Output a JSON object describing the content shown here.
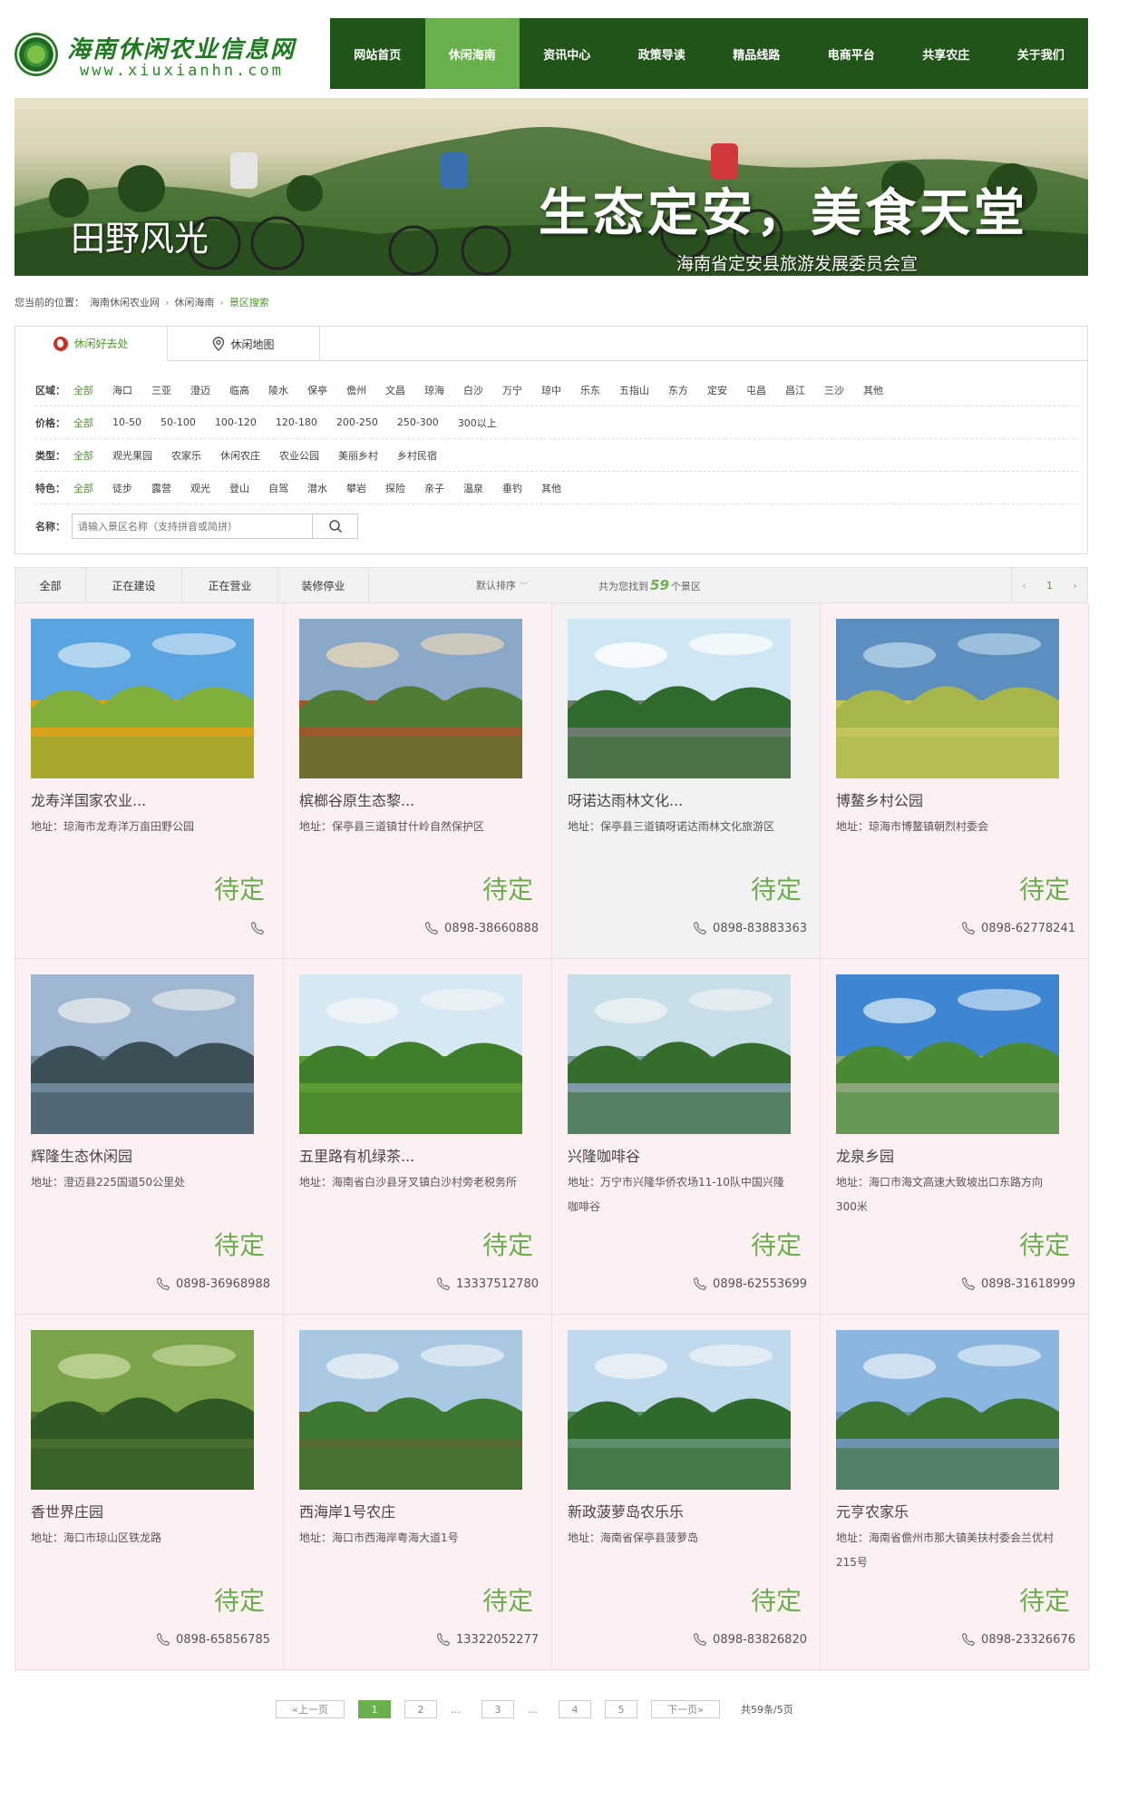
{
  "header": {
    "logo_title": "海南休闲农业信息网",
    "logo_url": "www.xiuxianhn.com",
    "nav": [
      {
        "label": "网站首页",
        "active": false
      },
      {
        "label": "休闲海南",
        "active": true
      },
      {
        "label": "资讯中心",
        "active": false
      },
      {
        "label": "政策导读",
        "active": false
      },
      {
        "label": "精品线路",
        "active": false
      },
      {
        "label": "电商平台",
        "active": false
      },
      {
        "label": "共享农庄",
        "active": false
      },
      {
        "label": "关于我们",
        "active": false
      }
    ]
  },
  "banner": {
    "left_text": "田野风光",
    "slogan": "生态定安，美食天堂",
    "credit": "海南省定安县旅游发展委员会宣"
  },
  "breadcrumb": {
    "prefix": "您当前的位置：",
    "items": [
      "海南休闲农业网",
      "休闲海南",
      "景区搜索"
    ]
  },
  "filter": {
    "tabs": [
      {
        "label": "休闲好去处",
        "icon": "globe-icon",
        "active": true
      },
      {
        "label": "休闲地图",
        "icon": "map-pin-icon",
        "active": false
      }
    ],
    "rows": [
      {
        "label": "区域：",
        "options": [
          "全部",
          "海口",
          "三亚",
          "澄迈",
          "临高",
          "陵水",
          "保亭",
          "儋州",
          "文昌",
          "琼海",
          "白沙",
          "万宁",
          "琼中",
          "乐东",
          "五指山",
          "东方",
          "定安",
          "屯昌",
          "昌江",
          "三沙",
          "其他"
        ]
      },
      {
        "label": "价格：",
        "options": [
          "全部",
          "10-50",
          "50-100",
          "100-120",
          "120-180",
          "200-250",
          "250-300",
          "300以上"
        ]
      },
      {
        "label": "类型：",
        "options": [
          "全部",
          "观光果园",
          "农家乐",
          "休闲农庄",
          "农业公园",
          "美丽乡村",
          "乡村民宿"
        ]
      },
      {
        "label": "特色：",
        "options": [
          "全部",
          "徒步",
          "露营",
          "观光",
          "登山",
          "自驾",
          "潜水",
          "攀岩",
          "探险",
          "亲子",
          "温泉",
          "垂钓",
          "其他"
        ]
      }
    ],
    "name_label": "名称：",
    "name_placeholder": "请输入景区名称（支持拼音或简拼）"
  },
  "sortbar": {
    "status_tabs": [
      "全部",
      "正在建设",
      "正在营业",
      "装修停业"
    ],
    "sort_label": "默认排序",
    "found_prefix": "共为您找到",
    "found_count": "59",
    "found_suffix": "个景区",
    "mini_page": "1"
  },
  "cards": [
    {
      "title": "龙寿洋国家农业...",
      "addr": "地址：琼海市龙寿洋万亩田野公园",
      "price": "待定",
      "phone": "",
      "hover": false
    },
    {
      "title": "槟榔谷原生态黎...",
      "addr": "地址：保亭县三道镇甘什岭自然保护区",
      "price": "待定",
      "phone": "0898-38660888",
      "hover": false
    },
    {
      "title": "呀诺达雨林文化...",
      "addr": "地址：保亭县三道镇呀诺达雨林文化旅游区",
      "price": "待定",
      "phone": "0898-83883363",
      "hover": true
    },
    {
      "title": "博鳌乡村公园",
      "addr": "地址：琼海市博鳌镇朝烈村委会",
      "price": "待定",
      "phone": "0898-62778241",
      "hover": false
    },
    {
      "title": "辉隆生态休闲园",
      "addr": "地址：澄迈县225国道50公里处",
      "price": "待定",
      "phone": "0898-36968988",
      "hover": false
    },
    {
      "title": "五里路有机绿茶...",
      "addr": "地址：海南省白沙县牙叉镇白沙村旁老税务所",
      "price": "待定",
      "phone": "13337512780",
      "hover": false
    },
    {
      "title": "兴隆咖啡谷",
      "addr": "地址：万宁市兴隆华侨农场11-10队中国兴隆咖啡谷",
      "price": "待定",
      "phone": "0898-62553699",
      "hover": false
    },
    {
      "title": "龙泉乡园",
      "addr": "地址：海口市海文高速大致坡出口东路方向300米",
      "price": "待定",
      "phone": "0898-31618999",
      "hover": false
    },
    {
      "title": "香世界庄园",
      "addr": "地址：海口市琼山区铁龙路",
      "price": "待定",
      "phone": "0898-65856785",
      "hover": false
    },
    {
      "title": "西海岸1号农庄",
      "addr": "地址：海口市西海岸粤海大道1号",
      "price": "待定",
      "phone": "13322052277",
      "hover": false
    },
    {
      "title": "新政菠萝岛农乐乐",
      "addr": "地址：海南省保亭县菠萝岛",
      "price": "待定",
      "phone": "0898-83826820",
      "hover": false
    },
    {
      "title": "元亨农家乐",
      "addr": "地址：海南省儋州市那大镇美扶村委会兰优村215号",
      "price": "待定",
      "phone": "0898-23326676",
      "hover": false
    }
  ],
  "pagination": {
    "prev": "«上一页",
    "pages": [
      "1",
      "2",
      "3",
      "4",
      "5"
    ],
    "current": "1",
    "ellipsis": "…",
    "next": "下一页»",
    "total": "共59条/5页"
  },
  "colors": {
    "nav_bg": "#215418",
    "accent": "#6ab04c",
    "card_bg": "#fdf0f3"
  }
}
